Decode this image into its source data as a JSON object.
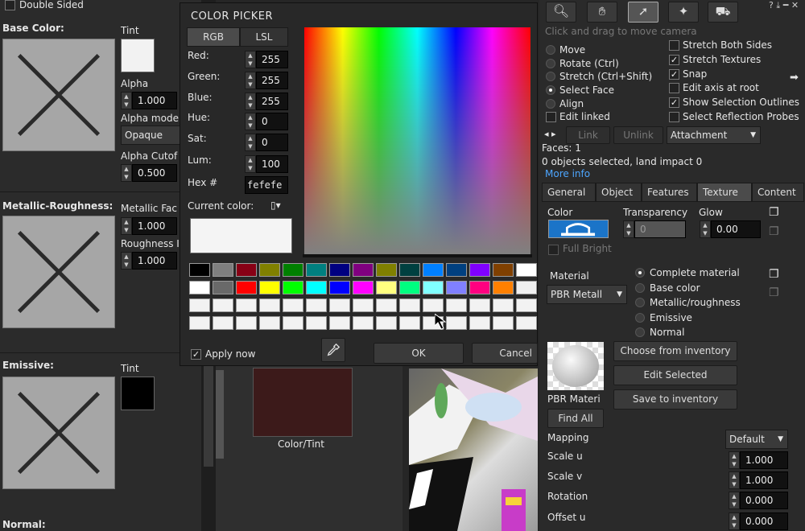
{
  "material": {
    "double_sided": "Double Sided",
    "base_color": "Base Color:",
    "tint": "Tint",
    "alpha": "Alpha",
    "alpha_value": "1.000",
    "alpha_mode": "Alpha mode",
    "alpha_mode_value": "Opaque",
    "alpha_cutoff": "Alpha Cutof",
    "alpha_cutoff_value": "0.500",
    "metallic_roughness": "Metallic-Roughness:",
    "metallic_factor": "Metallic Fac",
    "metallic_value": "1.000",
    "roughness_factor": "Roughness I",
    "roughness_value": "1.000",
    "emissive": "Emissive:",
    "emissive_tint": "Tint",
    "normal": "Normal:",
    "color_tint": "Color/Tint",
    "base_tint_color": "#f2f2f2",
    "emissive_tint_color": "#000000",
    "color_tint_swatch": "#3c1a1a"
  },
  "picker": {
    "title": "COLOR PICKER",
    "tab_rgb": "RGB",
    "tab_lsl": "LSL",
    "red": "Red:",
    "red_value": "255",
    "green": "Green:",
    "green_value": "255",
    "blue": "Blue:",
    "blue_value": "255",
    "hue": "Hue:",
    "hue_value": "0",
    "sat": "Sat:",
    "sat_value": "0",
    "lum": "Lum:",
    "lum_value": "100",
    "hex": "Hex #",
    "hex_value": "fefefe",
    "current_color": "Current color:",
    "current_color_value": "#f4f4f4",
    "apply_now": "Apply now",
    "ok": "OK",
    "cancel": "Cancel",
    "palette_row1": [
      "#000000",
      "#7f7f7f",
      "#880015",
      "#808000",
      "#008000",
      "#008080",
      "#000080",
      "#800080",
      "#808000",
      "#004040",
      "#0080ff",
      "#004080",
      "#8000ff",
      "#804000",
      "#ffffff"
    ],
    "palette_row2": [
      "#ffffff",
      "#696969",
      "#ff0000",
      "#ffff00",
      "#00ff00",
      "#00ffff",
      "#0000ff",
      "#ff00ff",
      "#ffff80",
      "#00ff80",
      "#80ffff",
      "#8080ff",
      "#ff0080",
      "#ff8000",
      "#f0f0f0"
    ]
  },
  "tools": {
    "hint": "Click and drag to move camera",
    "move": "Move",
    "rotate": "Rotate (Ctrl)",
    "stretch": "Stretch (Ctrl+Shift)",
    "select_face": "Select Face",
    "align": "Align",
    "edit_linked": "Edit linked",
    "stretch_both": "Stretch Both Sides",
    "stretch_textures": "Stretch Textures",
    "snap": "Snap",
    "edit_axis": "Edit axis at root",
    "show_outlines": "Show Selection Outlines",
    "select_probes": "Select Reflection Probes",
    "link": "Link",
    "unlink": "Unlink",
    "attachment": "Attachment",
    "faces": "Faces: 1",
    "selected_info": "0 objects selected, land impact 0",
    "more_info": "More info"
  },
  "tabs": [
    "General",
    "Object",
    "Features",
    "Texture",
    "Content"
  ],
  "texture": {
    "color": "Color",
    "transparency": "Transparency",
    "transparency_value": "0",
    "glow": "Glow",
    "glow_value": "0.00",
    "full_bright": "Full Bright",
    "material": "Material",
    "material_value": "PBR Metall",
    "complete_material": "Complete material",
    "base_color": "Base color",
    "metallic_roughness": "Metallic/roughness",
    "emissive": "Emissive",
    "normal": "Normal",
    "choose_inventory": "Choose from inventory",
    "edit_selected": "Edit Selected",
    "save_inventory": "Save to inventory",
    "pbr_label": "PBR Materi",
    "find_all": "Find All",
    "mapping": "Mapping",
    "mapping_value": "Default",
    "scale_u": "Scale u",
    "scale_u_value": "1.000",
    "scale_v": "Scale v",
    "scale_v_value": "1.000",
    "rotation": "Rotation",
    "rotation_value": "0.000",
    "offset_u": "Offset u",
    "offset_u_value": "0.000"
  }
}
